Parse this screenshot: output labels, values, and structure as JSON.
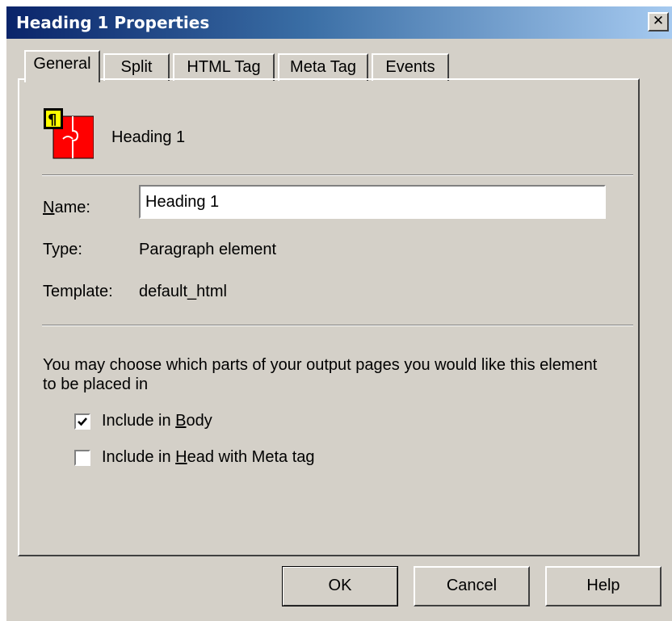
{
  "window": {
    "title": "Heading 1 Properties",
    "close_symbol": "✕"
  },
  "tabs": [
    {
      "label": "General",
      "active": true
    },
    {
      "label": "Split"
    },
    {
      "label": "HTML Tag"
    },
    {
      "label": "Meta Tag"
    },
    {
      "label": "Events"
    }
  ],
  "general": {
    "element_icon": "paragraph-element-icon",
    "element_name": "Heading 1",
    "name_label_accel": "N",
    "name_label_rest": "ame:",
    "name_value": "Heading 1",
    "type_label": "Type:",
    "type_value": "Paragraph element",
    "template_label": "Template:",
    "template_value": "default_html",
    "description": "You may choose which parts of your output pages you would like this element to be placed in",
    "include_body": {
      "pre": "Include in ",
      "accel": "B",
      "post": "ody",
      "checked": true
    },
    "include_head": {
      "pre": "Include in ",
      "accel": "H",
      "post": "ead with Meta tag",
      "checked": false
    }
  },
  "buttons": {
    "ok": "OK",
    "cancel": "Cancel",
    "help": "Help"
  }
}
